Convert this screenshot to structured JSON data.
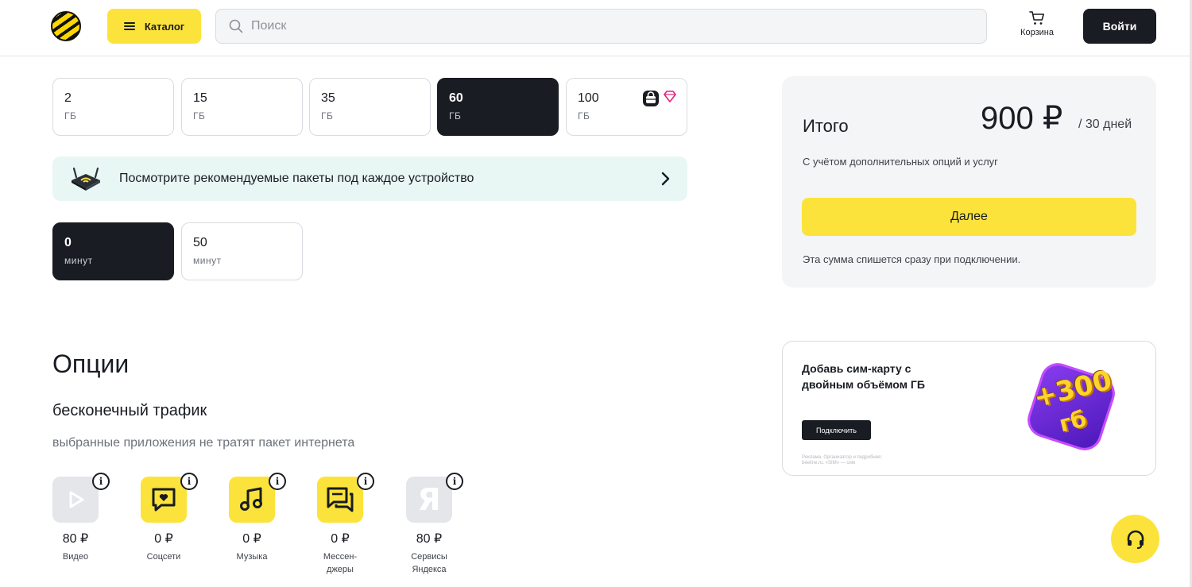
{
  "header": {
    "catalog_label": "Каталог",
    "search_placeholder": "Поиск",
    "cart_label": "Корзина",
    "login_label": "Войти"
  },
  "data_packages": [
    {
      "value": "2",
      "unit": "ГБ",
      "selected": false
    },
    {
      "value": "15",
      "unit": "ГБ",
      "selected": false
    },
    {
      "value": "35",
      "unit": "ГБ",
      "selected": false
    },
    {
      "value": "60",
      "unit": "ГБ",
      "selected": true
    },
    {
      "value": "100",
      "unit": "ГБ",
      "selected": false,
      "icons": [
        "shop-bag-icon",
        "diamond-icon"
      ]
    }
  ],
  "recommend_banner": {
    "text": "Посмотрите рекомендуемые пакеты под каждое устройство",
    "icon": "router-icon"
  },
  "minute_packages": [
    {
      "value": "0",
      "unit": "минут",
      "selected": true
    },
    {
      "value": "50",
      "unit": "минут",
      "selected": false
    }
  ],
  "summary": {
    "title": "Итого",
    "price": "900 ₽",
    "period": "/ 30 дней",
    "note": "С учётом дополнительных опций и услуг",
    "next_label": "Далее",
    "footer": "Эта сумма спишется сразу при подключении."
  },
  "ad": {
    "title": "Добавь сим-карту с двойным объёмом ГБ",
    "button_label": "Подключить",
    "legal": "Реклама. Организатор и подробнее: beeline.ru. «SIM» — сим",
    "art_big": "+300",
    "art_small": "гб"
  },
  "options": {
    "heading": "Опции",
    "subheading": "бесконечный трафик",
    "description": "выбранные приложения не тратят пакет интернета",
    "apps": [
      {
        "name": "Видео",
        "price": "80 ₽",
        "icon": "play-icon"
      },
      {
        "name": "Соцсети",
        "price": "0 ₽",
        "icon": "heart-chat-icon"
      },
      {
        "name": "Музыка",
        "price": "0 ₽",
        "icon": "music-note-icon"
      },
      {
        "name": "Мессен-\nджеры",
        "price": "0 ₽",
        "icon": "messages-icon"
      },
      {
        "name": "Сервисы\nЯндекса",
        "price": "80 ₽",
        "icon": "yandex-icon"
      }
    ]
  },
  "colors": {
    "accent_yellow": "#fce33b",
    "dark": "#191c22",
    "banner_bg": "#e9f7f4",
    "summary_bg": "#f4f5f6"
  }
}
